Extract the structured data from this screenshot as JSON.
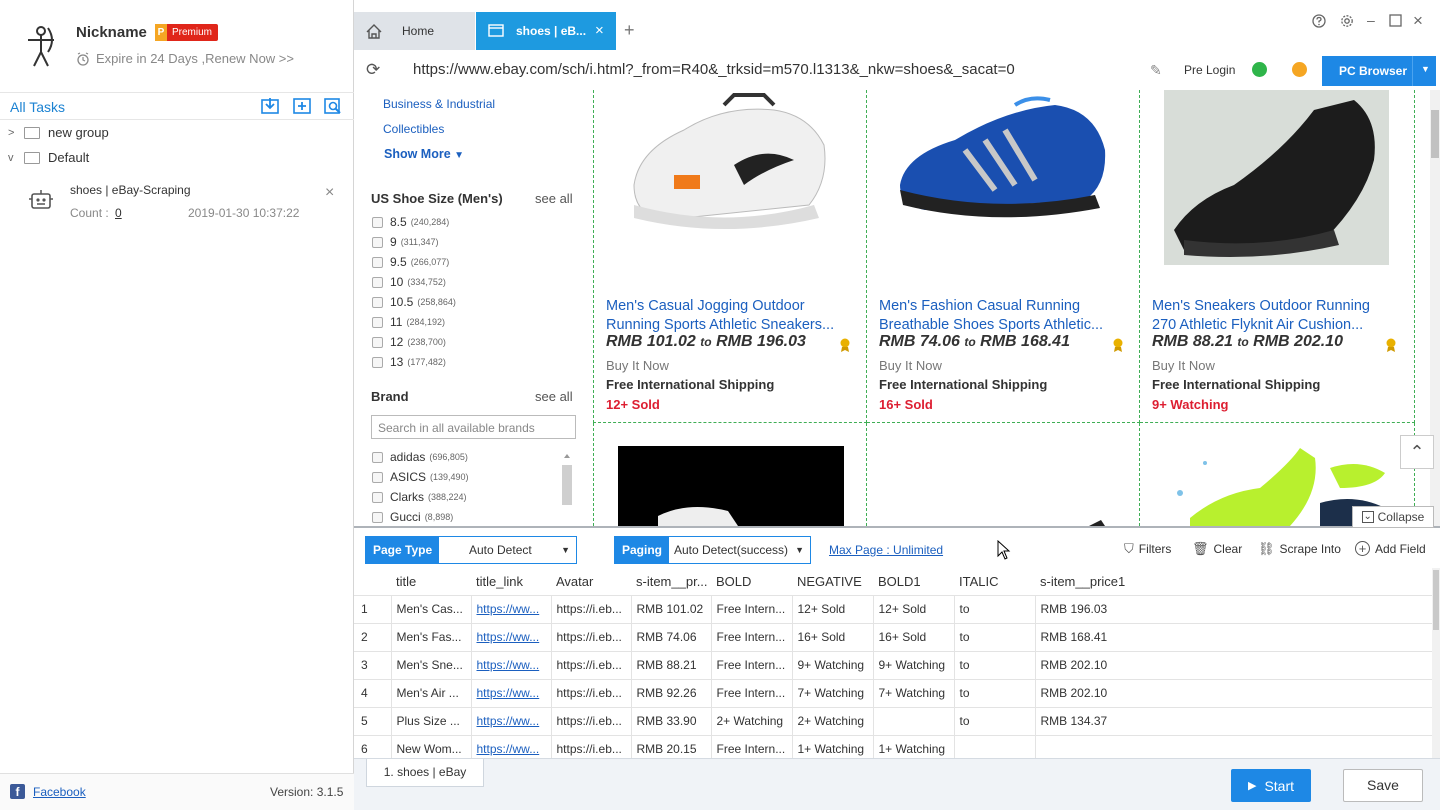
{
  "profile": {
    "nickname": "Nickname",
    "premium_letter": "P",
    "premium_label": "Premium",
    "expire": "Expire in 24 Days ,Renew Now >>"
  },
  "tasks": {
    "title": "All Tasks",
    "groups": [
      {
        "chevron": ">",
        "name": "new group"
      },
      {
        "chevron": "v",
        "name": "Default"
      }
    ],
    "item": {
      "name": "shoes | eBay-Scraping",
      "count_label": "Count :",
      "count": "0",
      "date": "2019-01-30 10:37:22"
    }
  },
  "left_footer": {
    "facebook_label": "Facebook",
    "version": "Version: 3.1.5"
  },
  "tabs": {
    "home": "Home",
    "shoes": "shoes | eB..."
  },
  "url_bar": {
    "url": "https://www.ebay.com/sch/i.html?_from=R40&_trksid=m570.l1313&_nkw=shoes&_sacat=0",
    "pre_login": "Pre Login",
    "pc_browser": "PC Browser"
  },
  "web": {
    "categories": [
      "Business & Industrial",
      "Collectibles"
    ],
    "show_more": "Show More",
    "size_facet": {
      "title": "US Shoe Size (Men's)",
      "see_all": "see all",
      "options": [
        {
          "label": "8.5",
          "count": "(240,284)"
        },
        {
          "label": "9",
          "count": "(311,347)"
        },
        {
          "label": "9.5",
          "count": "(266,077)"
        },
        {
          "label": "10",
          "count": "(334,752)"
        },
        {
          "label": "10.5",
          "count": "(258,864)"
        },
        {
          "label": "11",
          "count": "(284,192)"
        },
        {
          "label": "12",
          "count": "(238,700)"
        },
        {
          "label": "13",
          "count": "(177,482)"
        }
      ]
    },
    "brand_facet": {
      "title": "Brand",
      "see_all": "see all",
      "search_placeholder": "Search in all available brands",
      "options": [
        {
          "label": "adidas",
          "count": "(696,805)"
        },
        {
          "label": "ASICS",
          "count": "(139,490)"
        },
        {
          "label": "Clarks",
          "count": "(388,224)"
        },
        {
          "label": "Gucci",
          "count": "(8,898)"
        }
      ]
    },
    "products": [
      {
        "title1": "Men's Casual Jogging Outdoor",
        "title2": "Running Sports Athletic Sneakers...",
        "price_low": "RMB 101.02",
        "to": "to",
        "price_high": "RMB 196.03",
        "buy": "Buy It Now",
        "shipping": "Free International Shipping",
        "sold": "12+ Sold"
      },
      {
        "title1": "Men's Fashion Casual Running",
        "title2": "Breathable Shoes Sports Athletic...",
        "price_low": "RMB 74.06",
        "to": "to",
        "price_high": "RMB 168.41",
        "buy": "Buy It Now",
        "shipping": "Free International Shipping",
        "sold": "16+ Sold"
      },
      {
        "title1": "Men's Sneakers Outdoor Running",
        "title2": "270 Athletic Flyknit Air Cushion...",
        "price_low": "RMB 88.21",
        "to": "to",
        "price_high": "RMB 202.10",
        "buy": "Buy It Now",
        "shipping": "Free International Shipping",
        "sold": "9+ Watching"
      }
    ]
  },
  "panel": {
    "collapse": "Collapse",
    "page_type_label": "Page Type",
    "page_type_value": "Auto Detect",
    "paging_label": "Paging",
    "paging_value": "Auto Detect(success)",
    "max_page": "Max Page : Unlimited",
    "filters": "Filters",
    "clear": "Clear",
    "scrape_into": "Scrape Into",
    "add_field": "Add Field",
    "columns": [
      "",
      "title",
      "title_link",
      "Avatar",
      "s-item__pr...",
      "BOLD",
      "NEGATIVE",
      "BOLD1",
      "ITALIC",
      "s-item__price1"
    ],
    "rows": [
      [
        "1",
        "Men's Cas...",
        "https://ww...",
        "https://i.eb...",
        "RMB 101.02",
        "Free Intern...",
        "12+ Sold",
        "12+ Sold",
        "to",
        "RMB 196.03"
      ],
      [
        "2",
        "Men's Fas...",
        "https://ww...",
        "https://i.eb...",
        "RMB 74.06",
        "Free Intern...",
        "16+ Sold",
        "16+ Sold",
        "to",
        "RMB 168.41"
      ],
      [
        "3",
        "Men's Sne...",
        "https://ww...",
        "https://i.eb...",
        "RMB 88.21",
        "Free Intern...",
        "9+ Watching",
        "9+ Watching",
        "to",
        "RMB 202.10"
      ],
      [
        "4",
        "Men's Air ...",
        "https://ww...",
        "https://i.eb...",
        "RMB 92.26",
        "Free Intern...",
        "7+ Watching",
        "7+ Watching",
        "to",
        "RMB 202.10"
      ],
      [
        "5",
        "Plus Size ...",
        "https://ww...",
        "https://i.eb...",
        "RMB 33.90",
        "2+ Watching",
        "2+ Watching",
        "",
        "to",
        "RMB 134.37"
      ],
      [
        "6",
        "New Wom...",
        "https://ww...",
        "https://i.eb...",
        "RMB 20.15",
        "Free Intern...",
        "1+ Watching",
        "1+ Watching",
        "",
        ""
      ]
    ]
  },
  "footer": {
    "tab": "1. shoes | eBay",
    "start": "Start",
    "save": "Save"
  },
  "colors": {
    "accent": "#1e88e5",
    "tab_active": "#1e9ae0",
    "link": "#1b5fbf",
    "sold_red": "#dd1e31",
    "premium_red": "#e0261a",
    "grid_dash": "#3fae55"
  }
}
